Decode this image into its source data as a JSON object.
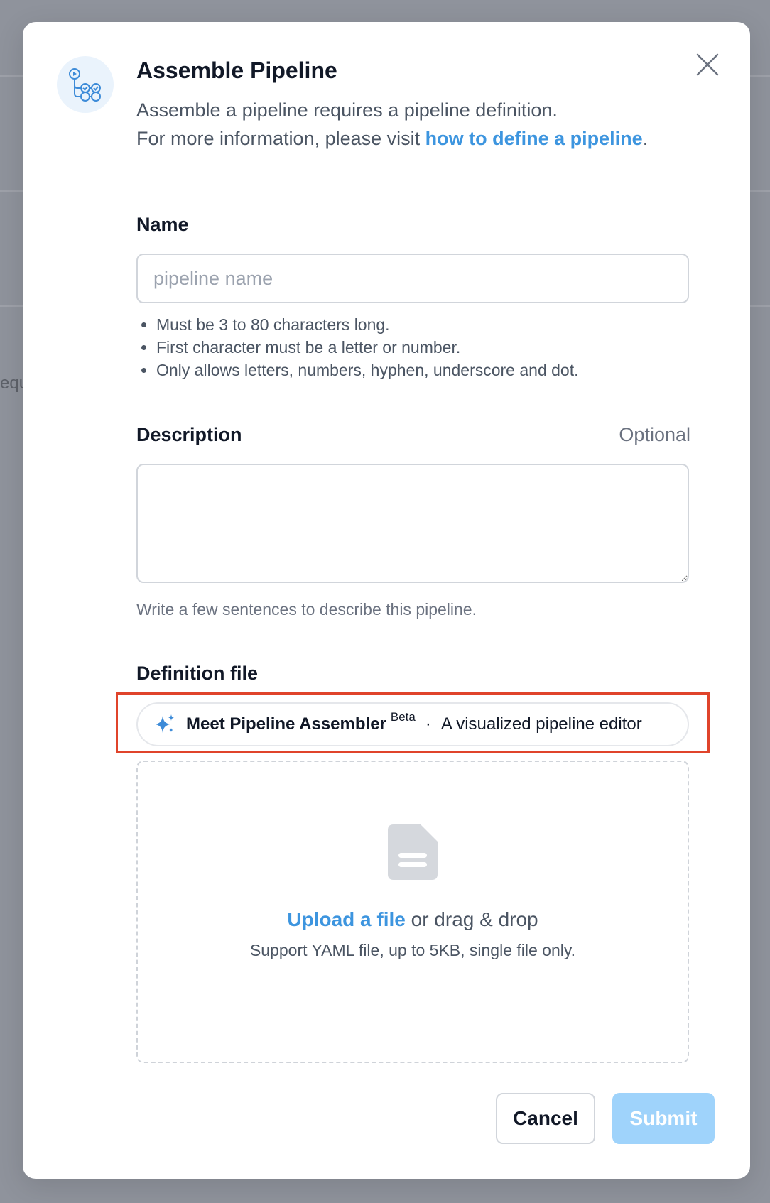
{
  "background": {
    "partial_text": "equ"
  },
  "modal": {
    "title": "Assemble Pipeline",
    "subtitle_line1": "Assemble a pipeline requires a pipeline definition.",
    "subtitle_line2_prefix": "For more information, please visit ",
    "subtitle_link": "how to define a pipeline",
    "subtitle_line2_suffix": ".",
    "header_icon": "pipeline-icon",
    "close_icon": "close-icon"
  },
  "name_field": {
    "label": "Name",
    "placeholder": "pipeline name",
    "value": "",
    "rules": [
      "Must be 3 to 80 characters long.",
      "First character must be a letter or number.",
      "Only allows letters, numbers, hyphen, underscore and dot."
    ]
  },
  "description_field": {
    "label": "Description",
    "optional_label": "Optional",
    "value": "",
    "help": "Write a few sentences to describe this pipeline."
  },
  "definition_file": {
    "label": "Definition file",
    "assembler": {
      "icon": "sparkle-icon",
      "name": "Meet Pipeline Assembler",
      "badge": "Beta",
      "separator": "·",
      "tagline": "A visualized pipeline editor"
    },
    "dropzone": {
      "icon": "file-icon",
      "upload_link": "Upload a file",
      "upload_suffix": " or drag & drop",
      "support_text": "Support YAML file, up to 5KB, single file only."
    }
  },
  "actions": {
    "cancel_label": "Cancel",
    "submit_label": "Submit"
  },
  "colors": {
    "accent": "#3d95df",
    "highlight_border": "#e0442b",
    "submit_disabled": "#9fd3fb",
    "overlay": "#8f939c"
  }
}
